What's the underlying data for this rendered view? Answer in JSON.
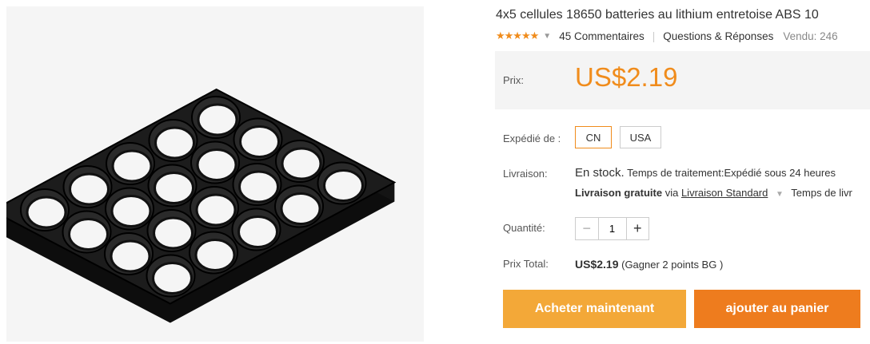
{
  "product": {
    "title": "4x5 cellules 18650 batteries au lithium entretoise ABS 10",
    "image_alt": "battery-holder-grid"
  },
  "meta": {
    "stars": "★★★★★",
    "reviews": "45 Commentaires",
    "qa": "Questions & Réponses",
    "sold": "Vendu: 246"
  },
  "price": {
    "label": "Prix:",
    "value": "US$2.19"
  },
  "shipping": {
    "label": "Expédié de :",
    "options": [
      "CN",
      "USA"
    ],
    "selected": "CN"
  },
  "delivery": {
    "label": "Livraison:",
    "stock": "En stock.",
    "processing": "Temps de traitement:Expédié sous 24 heures",
    "free": "Livraison gratuite",
    "via": "via",
    "method": "Livraison Standard",
    "time": "Temps de livr"
  },
  "quantity": {
    "label": "Quantité:",
    "value": "1",
    "minus": "−",
    "plus": "+"
  },
  "total": {
    "label": "Prix Total:",
    "amount": "US$2.19",
    "points": "(Gagner 2 points BG )"
  },
  "buttons": {
    "buy": "Acheter maintenant",
    "cart": "ajouter au panier"
  },
  "colors": {
    "accent": "#f08c1c",
    "buy": "#f3a838",
    "cart": "#ee7c1e"
  }
}
